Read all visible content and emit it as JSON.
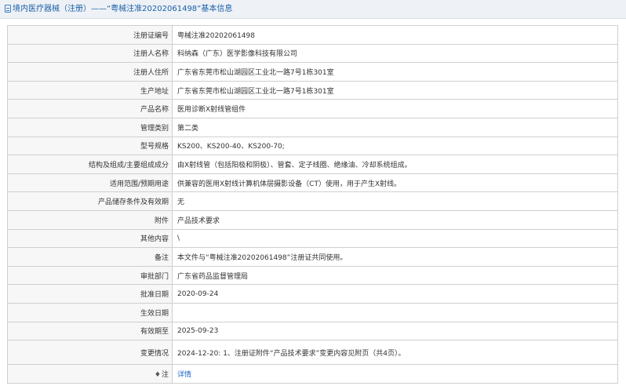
{
  "header": {
    "title": "境内医疗器械（注册）——“粤械注准20202061498”基本信息"
  },
  "rows": [
    {
      "label": "注册证编号",
      "value": "粤械注准20202061498"
    },
    {
      "label": "注册人名称",
      "value": "科纳森（广东）医学影像科技有限公司"
    },
    {
      "label": "注册人住所",
      "value": "广东省东莞市松山湖园区工业北一路7号1栋301室"
    },
    {
      "label": "生产地址",
      "value": "广东省东莞市松山湖园区工业北一路7号1栋301室"
    },
    {
      "label": "产品名称",
      "value": "医用诊断X射线管组件"
    },
    {
      "label": "管理类别",
      "value": "第二类"
    },
    {
      "label": "型号规格",
      "value": "KS200、KS200-40、KS200-70;"
    },
    {
      "label": "结构及组成/主要组成成分",
      "value": "由X射线管（包括阳极和阴极）、管套、定子线圈、绝缘油、冷却系统组成。"
    },
    {
      "label": "适用范围/预期用途",
      "value": "供兼容的医用X射线计算机体层摄影设备（CT）使用，用于产生X射线。"
    },
    {
      "label": "产品储存条件及有效期",
      "value": "无"
    },
    {
      "label": "附件",
      "value": "产品技术要求"
    },
    {
      "label": "其他内容",
      "value": "\\"
    },
    {
      "label": "备注",
      "value": "本文件与“粤械注准20202061498”注册证共同使用。"
    },
    {
      "label": "审批部门",
      "value": "广东省药品监督管理局"
    },
    {
      "label": "批准日期",
      "value": "2020-09-24"
    },
    {
      "label": "生效日期",
      "value": ""
    },
    {
      "label": "有效期至",
      "value": "2025-09-23"
    },
    {
      "label": "变更情况",
      "value": "2024-12-20: 1、注册证附件“产品技术要求”变更内容见附页（共4页）。"
    }
  ],
  "note": {
    "label": "注",
    "pin_glyph": "♦",
    "link_label": "详情"
  }
}
